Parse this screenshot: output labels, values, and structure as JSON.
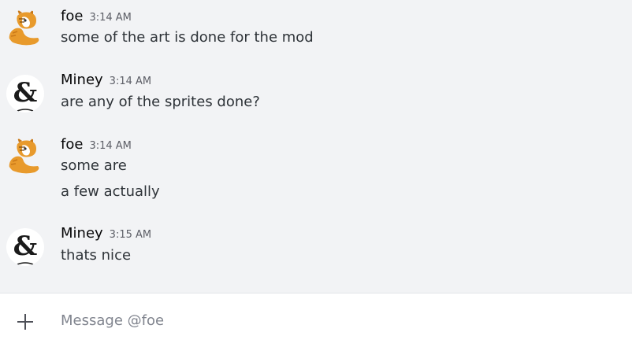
{
  "messages": [
    {
      "username": "foe",
      "timestamp": "3:14 AM",
      "avatar": "cat-avatar-icon",
      "lines": [
        "some of the art is done for the mod"
      ]
    },
    {
      "username": "Miney",
      "timestamp": "3:14 AM",
      "avatar": "ampersand-avatar-icon",
      "lines": [
        "are any of the sprites done?"
      ]
    },
    {
      "username": "foe",
      "timestamp": "3:14 AM",
      "avatar": "cat-avatar-icon",
      "lines": [
        "some are",
        "a few actually"
      ]
    },
    {
      "username": "Miney",
      "timestamp": "3:15 AM",
      "avatar": "ampersand-avatar-icon",
      "lines": [
        "thats nice"
      ]
    }
  ],
  "composer": {
    "placeholder": "Message @foe",
    "value": "",
    "attach_icon": "plus-icon"
  },
  "colors": {
    "background": "#f2f3f5",
    "composer_bg": "#ffffff",
    "username": "#060607",
    "timestamp": "#5c5e66",
    "text": "#2e3338"
  }
}
